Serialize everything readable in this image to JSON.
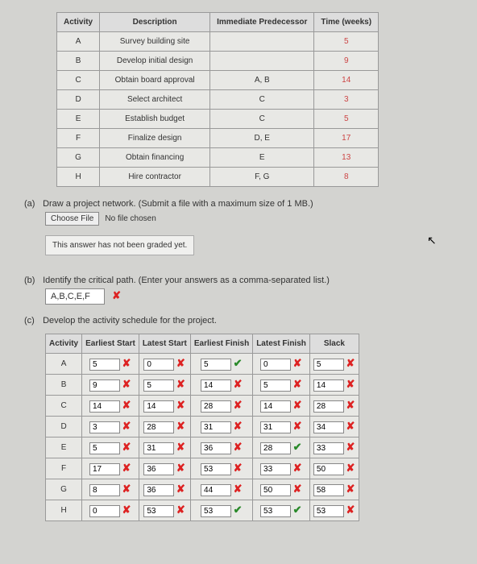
{
  "activity_table": {
    "headers": [
      "Activity",
      "Description",
      "Immediate Predecessor",
      "Time (weeks)"
    ],
    "rows": [
      {
        "activity": "A",
        "description": "Survey building site",
        "pred": "",
        "time": "5"
      },
      {
        "activity": "B",
        "description": "Develop initial design",
        "pred": "",
        "time": "9"
      },
      {
        "activity": "C",
        "description": "Obtain board approval",
        "pred": "A, B",
        "time": "14"
      },
      {
        "activity": "D",
        "description": "Select architect",
        "pred": "C",
        "time": "3"
      },
      {
        "activity": "E",
        "description": "Establish budget",
        "pred": "C",
        "time": "5"
      },
      {
        "activity": "F",
        "description": "Finalize design",
        "pred": "D, E",
        "time": "17"
      },
      {
        "activity": "G",
        "description": "Obtain financing",
        "pred": "E",
        "time": "13"
      },
      {
        "activity": "H",
        "description": "Hire contractor",
        "pred": "F, G",
        "time": "8"
      }
    ]
  },
  "part_a": {
    "label": "(a)",
    "text": "Draw a project network. (Submit a file with a maximum size of 1 MB.)",
    "choose_file": "Choose File",
    "no_file": "No file chosen",
    "not_graded": "This answer has not been graded yet."
  },
  "part_b": {
    "label": "(b)",
    "text": "Identify the critical path. (Enter your answers as a comma-separated list.)",
    "answer": "A,B,C,E,F",
    "mark": "✘"
  },
  "part_c": {
    "label": "(c)",
    "text": "Develop the activity schedule for the project.",
    "headers": [
      "Activity",
      "Earliest Start",
      "Latest Start",
      "Earliest Finish",
      "Latest Finish",
      "Slack"
    ],
    "rows": [
      {
        "act": "A",
        "es": {
          "v": "5",
          "m": "✘"
        },
        "ls": {
          "v": "0",
          "m": "✘"
        },
        "ef": {
          "v": "5",
          "m": "✔"
        },
        "lf": {
          "v": "0",
          "m": "✘"
        },
        "sl": {
          "v": "5",
          "m": "✘"
        }
      },
      {
        "act": "B",
        "es": {
          "v": "9",
          "m": "✘"
        },
        "ls": {
          "v": "5",
          "m": "✘"
        },
        "ef": {
          "v": "14",
          "m": "✘"
        },
        "lf": {
          "v": "5",
          "m": "✘"
        },
        "sl": {
          "v": "14",
          "m": "✘"
        }
      },
      {
        "act": "C",
        "es": {
          "v": "14",
          "m": "✘"
        },
        "ls": {
          "v": "14",
          "m": "✘"
        },
        "ef": {
          "v": "28",
          "m": "✘"
        },
        "lf": {
          "v": "14",
          "m": "✘"
        },
        "sl": {
          "v": "28",
          "m": "✘"
        }
      },
      {
        "act": "D",
        "es": {
          "v": "3",
          "m": "✘"
        },
        "ls": {
          "v": "28",
          "m": "✘"
        },
        "ef": {
          "v": "31",
          "m": "✘"
        },
        "lf": {
          "v": "31",
          "m": "✘"
        },
        "sl": {
          "v": "34",
          "m": "✘"
        }
      },
      {
        "act": "E",
        "es": {
          "v": "5",
          "m": "✘"
        },
        "ls": {
          "v": "31",
          "m": "✘"
        },
        "ef": {
          "v": "36",
          "m": "✘"
        },
        "lf": {
          "v": "28",
          "m": "✔"
        },
        "sl": {
          "v": "33",
          "m": "✘"
        }
      },
      {
        "act": "F",
        "es": {
          "v": "17",
          "m": "✘"
        },
        "ls": {
          "v": "36",
          "m": "✘"
        },
        "ef": {
          "v": "53",
          "m": "✘"
        },
        "lf": {
          "v": "33",
          "m": "✘"
        },
        "sl": {
          "v": "50",
          "m": "✘"
        }
      },
      {
        "act": "G",
        "es": {
          "v": "8",
          "m": "✘"
        },
        "ls": {
          "v": "36",
          "m": "✘"
        },
        "ef": {
          "v": "44",
          "m": "✘"
        },
        "lf": {
          "v": "50",
          "m": "✘"
        },
        "sl": {
          "v": "58",
          "m": "✘"
        }
      },
      {
        "act": "H",
        "es": {
          "v": "0",
          "m": "✘"
        },
        "ls": {
          "v": "53",
          "m": "✘"
        },
        "ef": {
          "v": "53",
          "m": "✔"
        },
        "lf": {
          "v": "53",
          "m": "✔"
        },
        "sl": {
          "v": "53",
          "m": "✘"
        }
      }
    ]
  },
  "chart_data": {
    "type": "table",
    "title": "Activity schedule",
    "columns": [
      "Activity",
      "Earliest Start",
      "Latest Start",
      "Earliest Finish",
      "Latest Finish",
      "Slack"
    ],
    "rows": [
      [
        "A",
        5,
        0,
        5,
        0,
        5
      ],
      [
        "B",
        9,
        5,
        14,
        5,
        14
      ],
      [
        "C",
        14,
        14,
        28,
        14,
        28
      ],
      [
        "D",
        3,
        28,
        31,
        31,
        34
      ],
      [
        "E",
        5,
        31,
        36,
        28,
        33
      ],
      [
        "F",
        17,
        36,
        53,
        33,
        50
      ],
      [
        "G",
        8,
        36,
        44,
        50,
        58
      ],
      [
        "H",
        0,
        53,
        53,
        53,
        53
      ]
    ]
  }
}
